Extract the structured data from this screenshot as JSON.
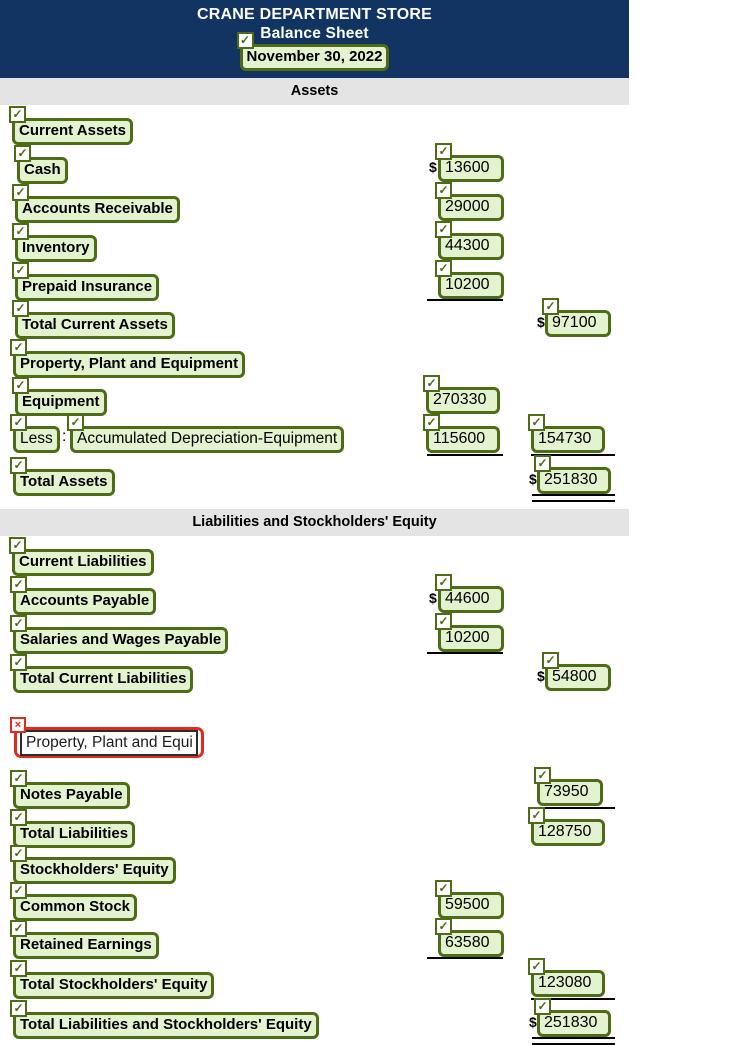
{
  "header": {
    "company": "CRANE DEPARTMENT STORE",
    "statement": "Balance Sheet",
    "date": "November 30, 2022"
  },
  "sections": {
    "assets_title": "Assets",
    "liabilities_title": "Liabilities and Stockholders' Equity"
  },
  "symbols": {
    "dollar": "$",
    "check": "✓",
    "cross": "×",
    "colon": ":"
  },
  "assets": {
    "current_assets_label": "Current Assets",
    "rows": [
      {
        "label": "Cash",
        "mid": "13600",
        "dollar_mid": true
      },
      {
        "label": "Accounts Receivable",
        "mid": "29000",
        "dollar_mid": false
      },
      {
        "label": "Inventory",
        "mid": "44300",
        "dollar_mid": false
      },
      {
        "label": "Prepaid Insurance",
        "mid": "10200",
        "dollar_mid": false
      }
    ],
    "total_current_assets_label": "Total Current Assets",
    "total_current_assets_value": "97100",
    "ppe_label": "Property, Plant and Equipment",
    "equipment_label": "Equipment",
    "equipment_value": "270330",
    "less_label": "Less",
    "accum_dep_label": "Accumulated Depreciation-Equipment",
    "accum_dep_value": "115600",
    "ppe_net_value": "154730",
    "total_assets_label": "Total Assets",
    "total_assets_value": "251830"
  },
  "liabilities": {
    "current_liabilities_label": "Current Liabilities",
    "rows": [
      {
        "label": "Accounts Payable",
        "mid": "44600",
        "dollar_mid": true
      },
      {
        "label": "Salaries and Wages Payable",
        "mid": "10200",
        "dollar_mid": false
      }
    ],
    "total_current_liabilities_label": "Total Current Liabilities",
    "total_current_liabilities_value": "54800",
    "error_field_value": "Property, Plant and Equi",
    "notes_payable_label": "Notes Payable",
    "notes_payable_value": "73950",
    "total_liabilities_label": "Total Liabilities",
    "total_liabilities_value": "128750"
  },
  "equity": {
    "stockholders_equity_label": "Stockholders' Equity",
    "common_stock_label": "Common Stock",
    "common_stock_value": "59500",
    "retained_earnings_label": "Retained Earnings",
    "retained_earnings_value": "63580",
    "total_equity_label": "Total Stockholders' Equity",
    "total_equity_value": "123080",
    "total_liab_equity_label": "Total Liabilities and Stockholders' Equity",
    "total_liab_equity_value": "251830"
  },
  "colors": {
    "header_navy": "#123463",
    "section_gray": "#e4e4e4",
    "field_fill": "#e3f2cf",
    "field_border": "#4e6b16",
    "error_border": "#e02b20"
  }
}
